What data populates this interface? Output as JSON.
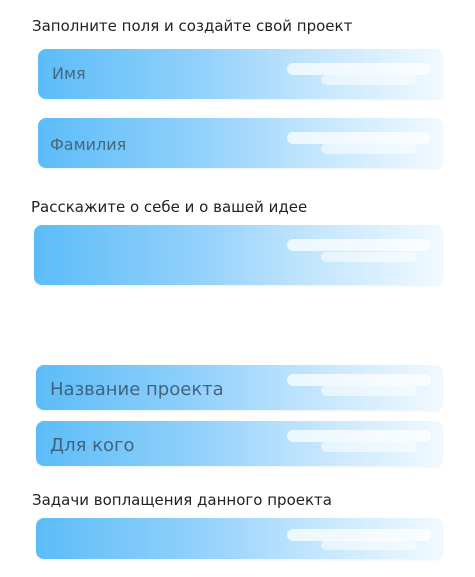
{
  "form": {
    "heading_create": "Заполните поля и создайте свой проект",
    "first_name_placeholder": "Имя",
    "last_name_placeholder": "Фамилия",
    "heading_about": "Расскажите о себе и о вашей идее",
    "about_value": "",
    "project_name_placeholder": "Название проекта",
    "for_whom_placeholder": "Для кого",
    "heading_tasks": "Задачи воплащения данного проекта",
    "tasks_value": ""
  },
  "colors": {
    "field_gradient_start": "#5cbcf8",
    "field_gradient_end": "#f1f9ff",
    "placeholder_text": "#3f5f75",
    "label_text": "#222222"
  }
}
